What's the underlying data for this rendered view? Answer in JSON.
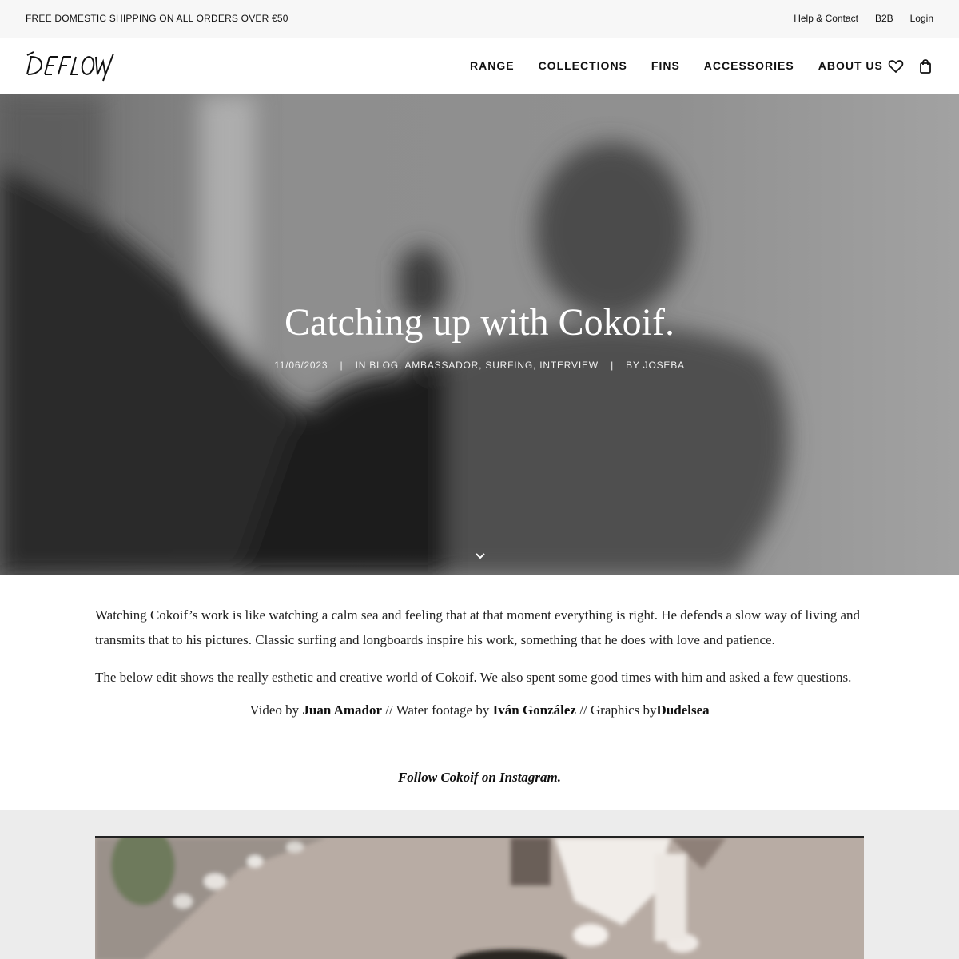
{
  "topbar": {
    "promo": "FREE DOMESTIC SHIPPING ON ALL ORDERS OVER €50",
    "links": [
      "Help & Contact",
      "B2B",
      "Login"
    ]
  },
  "header": {
    "logo_text": "DEFLOW",
    "nav": [
      "RANGE",
      "COLLECTIONS",
      "FINS",
      "ACCESSORIES",
      "ABOUT US"
    ],
    "icons": [
      "heart-icon",
      "shopping-bag-icon"
    ]
  },
  "hero": {
    "title": "Catching up with Cokoif.",
    "date": "11/06/2023",
    "separator": "|",
    "categories": "IN BLOG, AMBASSADOR, SURFING, INTERVIEW",
    "author": "BY JOSEBA",
    "scroll_icon": "chevron-down-icon"
  },
  "article": {
    "paragraph_1": "Watching Cokoif’s work is like watching a calm sea and feeling that at that moment everything is right. He defends a slow way of living and transmits that to his pictures. Classic surfing and longboards inspire his work, something that he does with love and patience.",
    "paragraph_2": "The below edit shows the really esthetic and creative world of Cokoif. We also spent some good times with him and asked a few questions.",
    "credits": {
      "video_prefix": "Video by ",
      "video_by": "Juan Amador",
      "water_prefix": " // Water footage by ",
      "water_by": "Iván González",
      "graphics_prefix": " // Graphics by",
      "graphics_by": "Dudelsea"
    },
    "follow_link": "Follow Cokoif on Instagram."
  },
  "colors": {
    "topbar_bg": "#f7f7f7",
    "gallery_bg": "#ececec",
    "text": "#111111"
  }
}
